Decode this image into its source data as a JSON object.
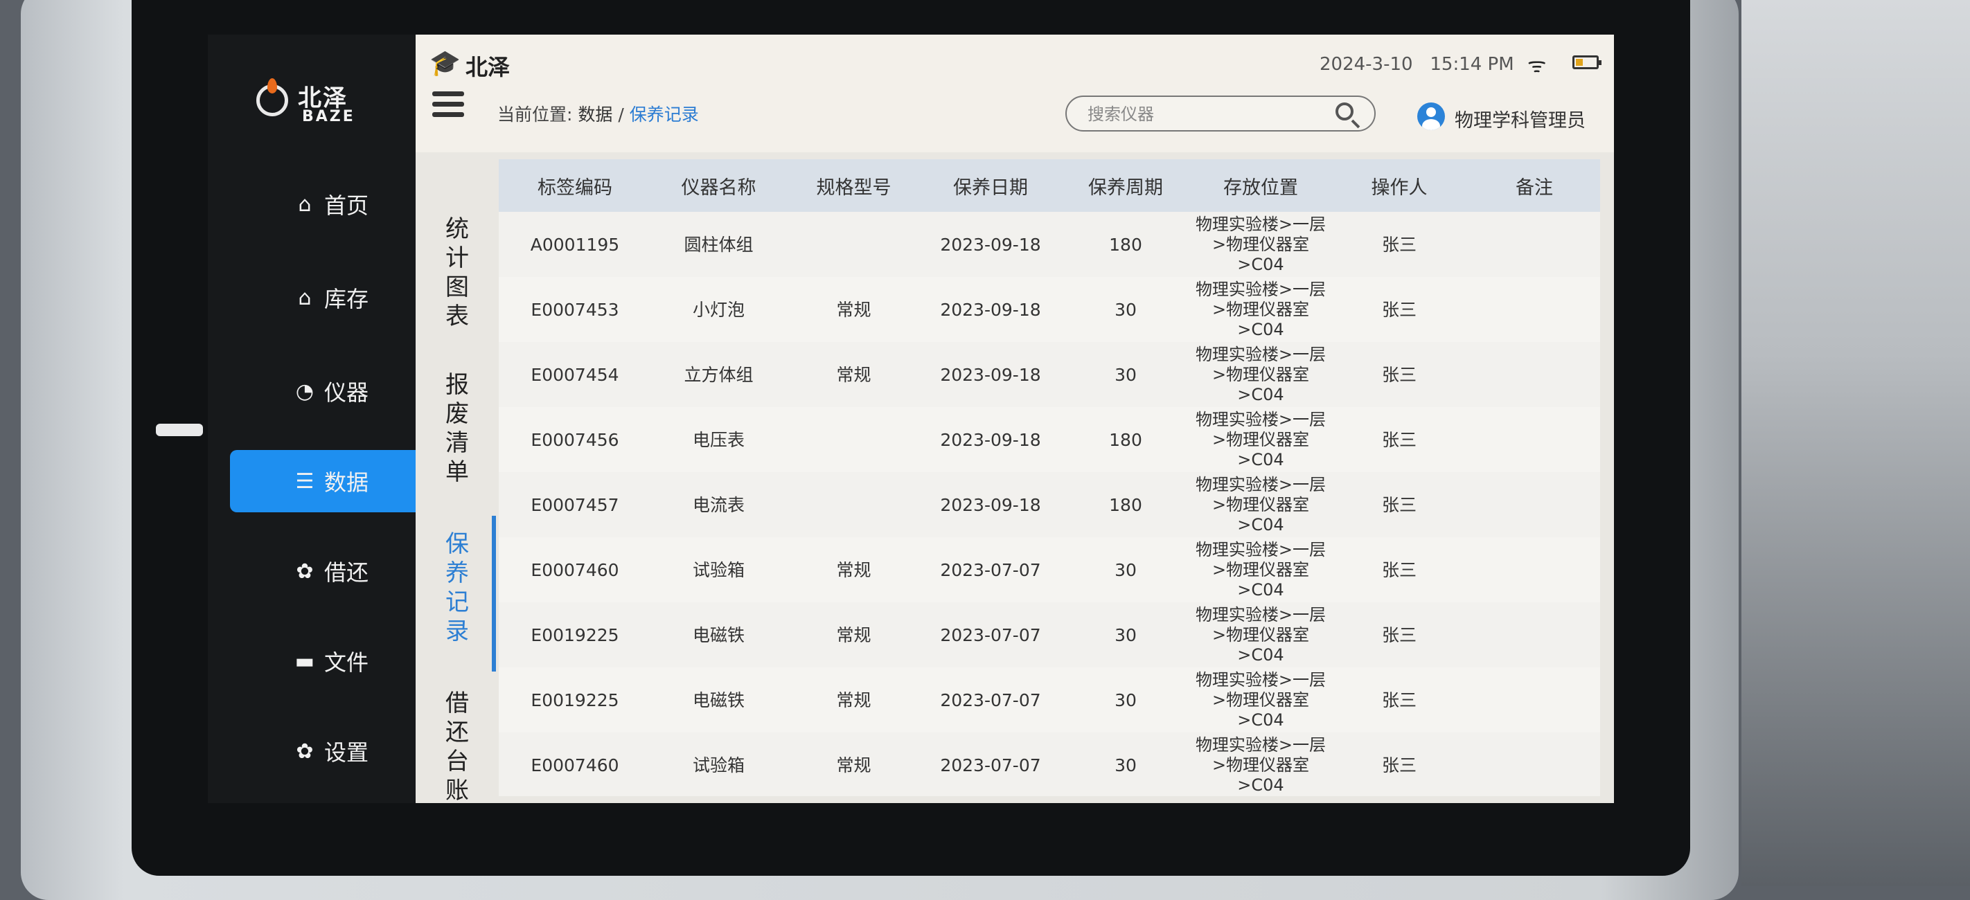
{
  "brand": {
    "logo_cn": "北泽",
    "logo_en": "BAZE",
    "header_name": "北泽"
  },
  "status": {
    "date": "2024-3-10",
    "time": "15:14 PM"
  },
  "nav": {
    "items": [
      {
        "label": "首页",
        "icon": "home-icon"
      },
      {
        "label": "库存",
        "icon": "warehouse-icon"
      },
      {
        "label": "仪器",
        "icon": "gauge-icon"
      },
      {
        "label": "数据",
        "icon": "database-icon",
        "active": true
      },
      {
        "label": "借还",
        "icon": "gear-icon"
      },
      {
        "label": "文件",
        "icon": "folder-icon"
      },
      {
        "label": "设置",
        "icon": "settings-icon"
      }
    ]
  },
  "breadcrumb": {
    "prefix": "当前位置:",
    "current": "数据",
    "separator": "/",
    "link": "保养记录"
  },
  "search": {
    "placeholder": "搜索仪器",
    "value": ""
  },
  "user": {
    "name": "物理学科管理员"
  },
  "tabs": [
    {
      "label": "统计图表"
    },
    {
      "label": "报废清单"
    },
    {
      "label": "保养记录",
      "active": true
    },
    {
      "label": "借还台账"
    }
  ],
  "table": {
    "columns": [
      "标签编码",
      "仪器名称",
      "规格型号",
      "保养日期",
      "保养周期",
      "存放位置",
      "操作人",
      "备注"
    ],
    "rows": [
      [
        "A0001195",
        "圆柱体组",
        "",
        "2023-09-18",
        "180",
        "物理实验楼>一层>物理仪器室>C04",
        "张三",
        ""
      ],
      [
        "E0007453",
        "小灯泡",
        "常规",
        "2023-09-18",
        "30",
        "物理实验楼>一层>物理仪器室>C04",
        "张三",
        ""
      ],
      [
        "E0007454",
        "立方体组",
        "常规",
        "2023-09-18",
        "30",
        "物理实验楼>一层>物理仪器室>C04",
        "张三",
        ""
      ],
      [
        "E0007456",
        "电压表",
        "",
        "2023-09-18",
        "180",
        "物理实验楼>一层>物理仪器室>C04",
        "张三",
        ""
      ],
      [
        "E0007457",
        "电流表",
        "",
        "2023-09-18",
        "180",
        "物理实验楼>一层>物理仪器室>C04",
        "张三",
        ""
      ],
      [
        "E0007460",
        "试验箱",
        "常规",
        "2023-07-07",
        "30",
        "物理实验楼>一层>物理仪器室>C04",
        "张三",
        ""
      ],
      [
        "E0019225",
        "电磁铁",
        "常规",
        "2023-07-07",
        "30",
        "物理实验楼>一层>物理仪器室>C04",
        "张三",
        ""
      ],
      [
        "E0019225",
        "电磁铁",
        "常规",
        "2023-07-07",
        "30",
        "物理实验楼>一层>物理仪器室>C04",
        "张三",
        ""
      ],
      [
        "E0007460",
        "试验箱",
        "常规",
        "2023-07-07",
        "30",
        "物理实验楼>一层>物理仪器室>C04",
        "张三",
        ""
      ]
    ]
  },
  "colors": {
    "accent": "#1e8ff0",
    "sidebar": "#17191b",
    "header_row": "#d9e0e8"
  }
}
